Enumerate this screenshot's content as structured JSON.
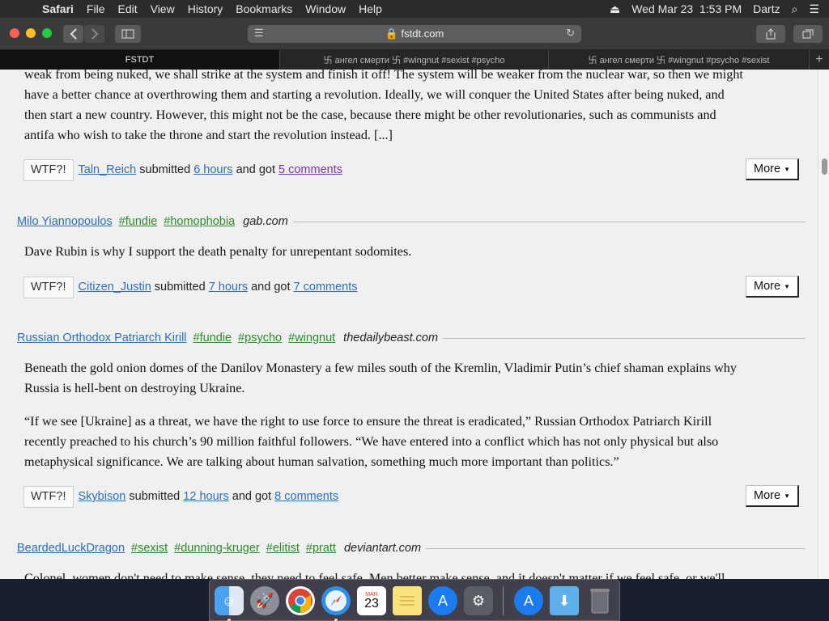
{
  "menubar": {
    "apple": "",
    "items": [
      "Safari",
      "File",
      "Edit",
      "View",
      "History",
      "Bookmarks",
      "Window",
      "Help"
    ],
    "datetime": "Wed Mar 23  1:53 PM",
    "user": "Dartz"
  },
  "toolbar": {
    "url": "fstdt.com"
  },
  "tabs": [
    "FSTDT",
    "卐 ангел смерти 卐 #wingnut #sexist #psycho",
    "卐 ангел смерти 卐 #wingnut #psycho #sexist"
  ],
  "post0": {
    "lines": [
      "weak from being nuked, we shall strike at the system and finish it off! The system will be weaker from the nuclear war, so then we might",
      "have a better chance at overthrowing them and starting a revolution. Ideally, we will conquer the United States after being nuked, and",
      "then start a new country. However, this might not be the case, because there might be other revolutionaries, such as communists and",
      "antifa who wish to take the throne and start the revolution instead. [...]"
    ],
    "wtf": "WTF?!",
    "submitter": "Taln_Reich",
    "submitted": "submitted",
    "time": "6 hours",
    "andgot": "and got",
    "comments": "5 comments",
    "more": "More"
  },
  "post1": {
    "author": "Milo Yiannopoulos",
    "tags": [
      "#fundie",
      "#homophobia"
    ],
    "source": "gab.com",
    "text": "Dave Rubin is why I support the death penalty for unrepentant sodomites.",
    "wtf": "WTF?!",
    "submitter": "Citizen_Justin",
    "submitted": "submitted",
    "time": "7 hours",
    "andgot": "and got",
    "comments": "7 comments",
    "more": "More"
  },
  "post2": {
    "author": "Russian Orthodox Patriarch Kirill",
    "tags": [
      "#fundie",
      "#psycho",
      "#wingnut"
    ],
    "source": "thedailybeast.com",
    "p1": [
      "Beneath the gold onion domes of the Danilov Monastery a few miles south of the Kremlin, Vladimir Putin’s chief shaman explains why",
      "Russia is hell-bent on destroying Ukraine."
    ],
    "p2": [
      "“If we see [Ukraine] as a threat, we have the right to use force to ensure the threat is eradicated,” Russian Orthodox Patriarch Kirill",
      "recently preached to his church’s 90 million faithful followers. “We have entered into a conflict which has not only physical but also",
      "metaphysical significance. We are talking about human salvation, something much more important than politics.”"
    ],
    "wtf": "WTF?!",
    "submitter": "Skybison",
    "submitted": "submitted",
    "time": "12 hours",
    "andgot": "and got",
    "comments": "8 comments",
    "more": "More"
  },
  "post3": {
    "author": "BeardedLuckDragon",
    "tags": [
      "#sexist",
      "#dunning-kruger",
      "#elitist",
      "#pratt"
    ],
    "source": "deviantart.com",
    "partial": "Colonel, women don't need to make sense, they need to feel safe. Men better make sense, and it doesn't matter if we feel safe, or we'll"
  },
  "dock": {
    "calendar_month": "MAR",
    "calendar_day": "23"
  }
}
